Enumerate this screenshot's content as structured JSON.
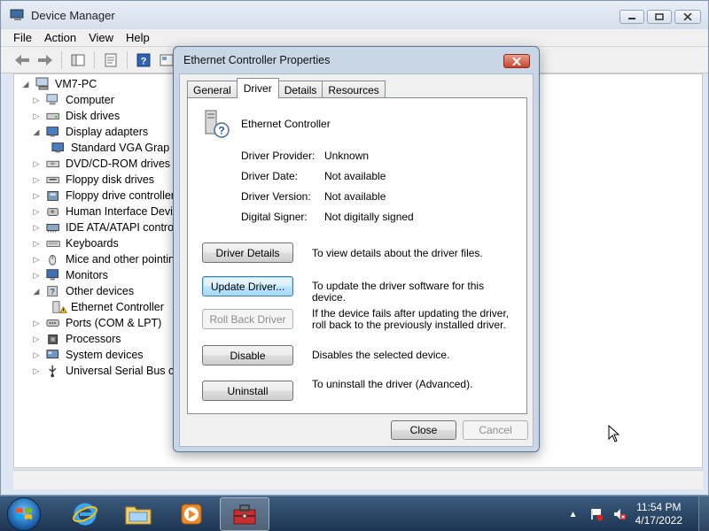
{
  "dm": {
    "title": "Device Manager",
    "menu": [
      "File",
      "Action",
      "View",
      "Help"
    ],
    "tree": {
      "root": "VM7-PC",
      "items": [
        {
          "label": "Computer",
          "expander": "▷",
          "icon": "computer-icon"
        },
        {
          "label": "Disk drives",
          "expander": "▷",
          "icon": "disk-drive-icon"
        },
        {
          "label": "Display adapters",
          "expander": "◢",
          "icon": "display-adapter-icon"
        },
        {
          "label": "Standard VGA Grap",
          "child": true,
          "icon": "display-adapter-icon"
        },
        {
          "label": "DVD/CD-ROM drives",
          "expander": "▷",
          "icon": "dvd-drive-icon"
        },
        {
          "label": "Floppy disk drives",
          "expander": "▷",
          "icon": "floppy-drive-icon"
        },
        {
          "label": "Floppy drive controller",
          "expander": "▷",
          "icon": "floppy-controller-icon"
        },
        {
          "label": "Human Interface Devic",
          "expander": "▷",
          "icon": "hid-icon"
        },
        {
          "label": "IDE ATA/ATAPI contro",
          "expander": "▷",
          "icon": "ide-controller-icon"
        },
        {
          "label": "Keyboards",
          "expander": "▷",
          "icon": "keyboard-icon"
        },
        {
          "label": "Mice and other pointin",
          "expander": "▷",
          "icon": "mouse-icon"
        },
        {
          "label": "Monitors",
          "expander": "▷",
          "icon": "monitor-icon"
        },
        {
          "label": "Other devices",
          "expander": "◢",
          "icon": "other-devices-icon"
        },
        {
          "label": "Ethernet Controller",
          "child": true,
          "icon": "unknown-device-warning-icon"
        },
        {
          "label": "Ports (COM & LPT)",
          "expander": "▷",
          "icon": "port-icon"
        },
        {
          "label": "Processors",
          "expander": "▷",
          "icon": "processor-icon"
        },
        {
          "label": "System devices",
          "expander": "▷",
          "icon": "system-device-icon"
        },
        {
          "label": "Universal Serial Bus co",
          "expander": "▷",
          "icon": "usb-icon"
        }
      ]
    }
  },
  "dialog": {
    "title": "Ethernet Controller Properties",
    "tabs": [
      "General",
      "Driver",
      "Details",
      "Resources"
    ],
    "active_tab": "Driver",
    "device_name": "Ethernet Controller",
    "props": [
      {
        "key": "Driver Provider:",
        "value": "Unknown"
      },
      {
        "key": "Driver Date:",
        "value": "Not available"
      },
      {
        "key": "Driver Version:",
        "value": "Not available"
      },
      {
        "key": "Digital Signer:",
        "value": "Not digitally signed"
      }
    ],
    "actions": [
      {
        "label": "Driver Details",
        "desc": "To view details about the driver files."
      },
      {
        "label": "Update Driver...",
        "desc": "To update the driver software for this device."
      },
      {
        "label": "Roll Back Driver",
        "desc": "If the device fails after updating the driver, roll back to the previously installed driver."
      },
      {
        "label": "Disable",
        "desc": "Disables the selected device."
      },
      {
        "label": "Uninstall",
        "desc": "To uninstall the driver (Advanced)."
      }
    ],
    "close_label": "Close",
    "cancel_label": "Cancel"
  },
  "taskbar": {
    "time": "11:54 PM",
    "date": "4/17/2022"
  }
}
